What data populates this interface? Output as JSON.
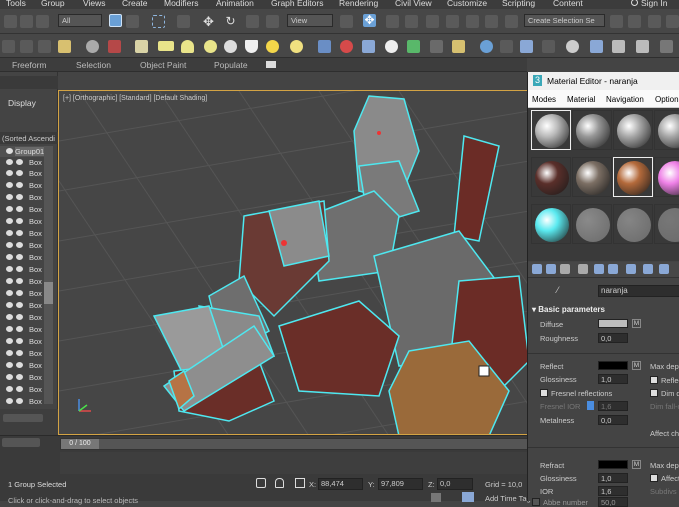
{
  "menubar": [
    "Tools",
    "Group",
    "Views",
    "Create",
    "Modifiers",
    "Animation",
    "Graph Editors",
    "Rendering",
    "Civil View",
    "Customize",
    "Scripting",
    "Content",
    "Sign In"
  ],
  "toolbar": {
    "filter": "All",
    "view": "View",
    "selection_set": "Create Selection Se"
  },
  "ribbon": {
    "tabs": [
      "Freeform",
      "Selection",
      "Object Paint",
      "Populate"
    ]
  },
  "scene_explorer": {
    "display_label": "Display",
    "sort_label": "(Sorted Ascendi",
    "group_label": "Group01",
    "box_label": "Box"
  },
  "viewport": {
    "label": "[+] [Orthographic] [Standard] [Default Shading]"
  },
  "status": {
    "selection": "1 Group Selected",
    "prompt": "Click or click-and-drag to select objects",
    "x_label": "X:",
    "x_value": "88,474",
    "y_label": "Y:",
    "y_value": "97,809",
    "z_label": "Z:",
    "z_value": "0,0",
    "grid": "Grid = 10,0",
    "add_time_tag": "Add Time Tag",
    "frame": "0 / 100"
  },
  "material_editor": {
    "title": "Material Editor - naranja",
    "menu": [
      "Modes",
      "Material",
      "Navigation",
      "Option"
    ],
    "material_name": "naranja",
    "rollout": "Basic parameters",
    "diffuse": "Diffuse",
    "roughness": "Roughness",
    "roughness_value": "0,0",
    "reflect": "Reflect",
    "max_depth": "Max dept",
    "glossiness": "Glossiness",
    "glossiness_value": "1,0",
    "reflect_on_back": "Reflect",
    "fresnel": "Fresnel reflections",
    "dim_distance": "Dim di",
    "fresnel_ior": "Fresnel IOR",
    "fresnel_ior_value": "1,6",
    "dim_falloff": "Dim fall-o",
    "metalness": "Metalness",
    "metalness_value": "0,0",
    "affect_channels": "Affect ch",
    "refract": "Refract",
    "max_depth2": "Max dept",
    "glossiness2": "Glossiness",
    "glossiness2_value": "1,0",
    "affect_shadows": "Affect",
    "ior": "IOR",
    "ior_value": "1,6",
    "subdivs": "Subdivs",
    "abbe": "Abbe number",
    "abbe_value": "50,0",
    "m_button": "M",
    "sample_colors": [
      "#b9b9b9",
      "#979797",
      "#a8a8a8",
      "#a6a6a6",
      "#5a2f2a",
      "#7c6f64",
      "#b46a3b",
      "#ee80e6",
      "#5aeaf0",
      "#8a8a8a",
      "#858585",
      "#777777"
    ]
  }
}
